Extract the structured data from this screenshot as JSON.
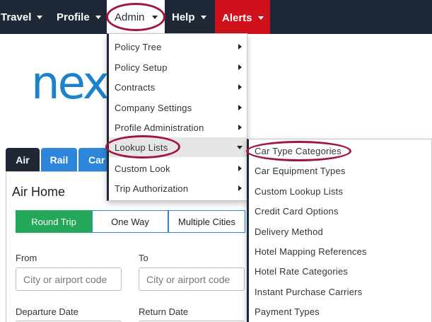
{
  "nav": {
    "travel": "Travel",
    "profile": "Profile",
    "admin": "Admin",
    "help": "Help",
    "alerts": "Alerts"
  },
  "colors": {
    "navbar": "#1f2836",
    "alerts": "#d0101b",
    "annotation": "#a0163e",
    "tab_blue": "#2d86d9",
    "round_trip_green": "#22a858",
    "logo": "#1c82c9"
  },
  "logo_text": "nex",
  "tabs": [
    "Air",
    "Rail",
    "Car"
  ],
  "air_home": {
    "title": "Air Home",
    "trip_types": [
      "Round Trip",
      "One Way",
      "Multiple Cities"
    ],
    "from_label": "From",
    "to_label": "To",
    "from_placeholder": "City or airport code",
    "to_placeholder": "City or airport code",
    "departure_label": "Departure Date",
    "return_label": "Return Date"
  },
  "admin_menu": [
    "Policy Tree",
    "Policy Setup",
    "Contracts",
    "Company Settings",
    "Profile Administration",
    "Lookup Lists",
    "Custom Look",
    "Trip Authorization"
  ],
  "lookup_menu": [
    "Car Type Categories",
    "Car Equipment Types",
    "Custom Lookup Lists",
    "Credit Card Options",
    "Delivery Method",
    "Hotel Mapping References",
    "Hotel Rate Categories",
    "Instant Purchase Carriers",
    "Payment Types"
  ]
}
